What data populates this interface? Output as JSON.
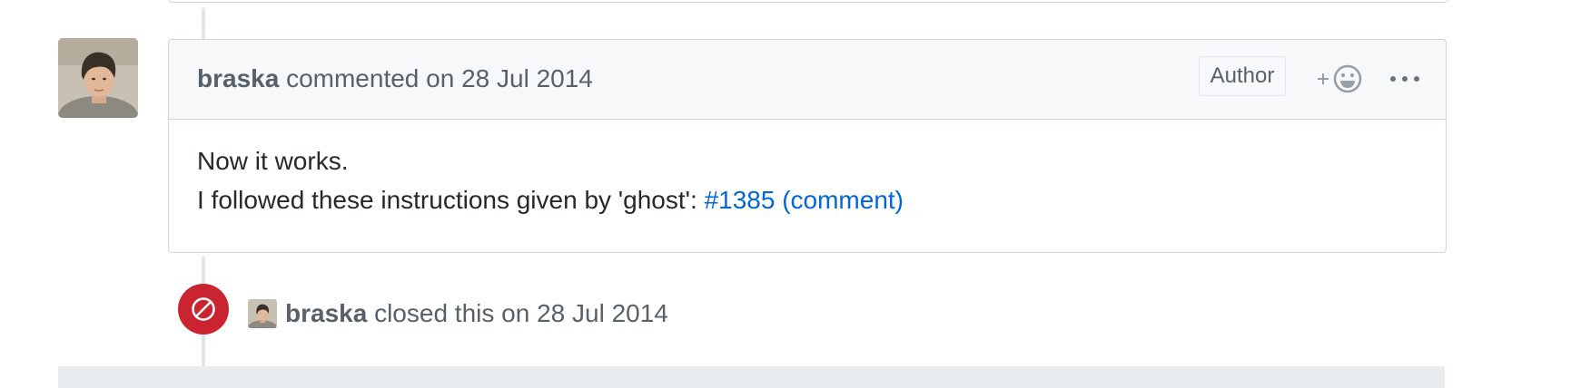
{
  "comment": {
    "author": "braska",
    "action_text": "commented on 28 Jul 2014",
    "badge": "Author",
    "reaction_plus": "+",
    "body_line1": "Now it works.",
    "body_line2_prefix": "I followed these instructions given by 'ghost': ",
    "link_text": "#1385 (comment)"
  },
  "event": {
    "author": "braska",
    "text": "closed this on 28 Jul 2014",
    "icon": "circle-slash-icon",
    "color": "#cb2431"
  },
  "colors": {
    "link": "#0366d6",
    "header_bg": "#f6f8fa",
    "border": "#d1d5da",
    "muted_text": "#586069"
  }
}
